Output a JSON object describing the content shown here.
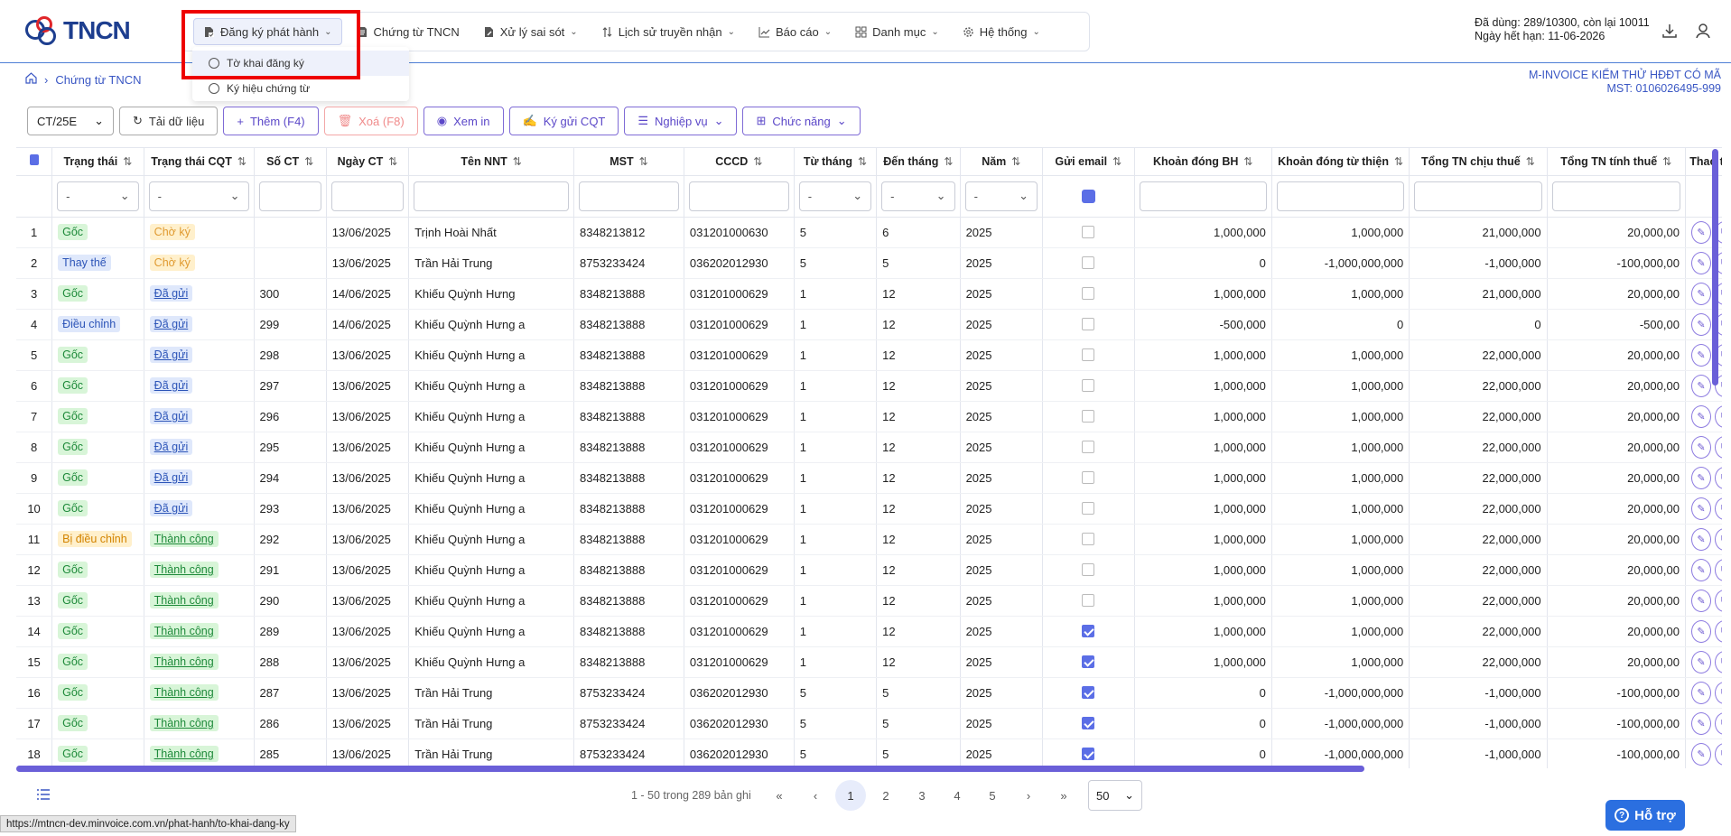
{
  "header": {
    "logo_text": "TNCN",
    "nav": [
      {
        "label": "Đăng ký phát hành",
        "icon": "file-register-icon",
        "has_menu": true
      },
      {
        "label": "Chứng từ TNCN",
        "icon": "document-icon",
        "has_menu": false
      },
      {
        "label": "Xử lý sai sót",
        "icon": "file-edit-icon",
        "has_menu": true
      },
      {
        "label": "Lịch sử truyền nhận",
        "icon": "transfer-icon",
        "has_menu": true
      },
      {
        "label": "Báo cáo",
        "icon": "chart-icon",
        "has_menu": true
      },
      {
        "label": "Danh mục",
        "icon": "grid-icon",
        "has_menu": true
      },
      {
        "label": "Hệ thống",
        "icon": "gear-icon",
        "has_menu": true
      }
    ],
    "dropdown": [
      "Tờ khai đăng ký",
      "Ký hiệu chứng từ"
    ],
    "quota_line1": "Đã dùng: 289/10300, còn lại 10011",
    "quota_line2": "Ngày hết hạn: 11-06-2026"
  },
  "breadcrumb": {
    "page": "Chứng từ TNCN"
  },
  "company": {
    "name": "M-INVOICE KIỂM THỬ HĐĐT CÓ MÃ",
    "mst": "MST: 0106026495-999"
  },
  "toolbar": {
    "series": "CT/25E",
    "reload": "Tải dữ liệu",
    "add": "Thêm (F4)",
    "delete": "Xoá (F8)",
    "view": "Xem in",
    "sign": "Ký gửi CQT",
    "ops": "Nghiệp vụ",
    "functions": "Chức năng"
  },
  "columns": [
    "Trạng thái",
    "Trạng thái CQT",
    "Số CT",
    "Ngày CT",
    "Tên NNT",
    "MST",
    "CCCD",
    "Từ tháng",
    "Đến tháng",
    "Năm",
    "Gửi email",
    "Khoản đóng BH",
    "Khoản đóng từ thiện",
    "Tổng TN chịu thuế",
    "Tổng TN tính thuế",
    "Thao tác"
  ],
  "filter_placeholder": "-",
  "rows": [
    {
      "n": "1",
      "st": "Gốc",
      "cqt": "Chờ ký",
      "so": "",
      "ngay": "13/06/2025",
      "ten": "Trịnh Hoài Nhất",
      "mst": "8348213812",
      "cccd": "031201000630",
      "tu": "5",
      "den": "6",
      "nam": "2025",
      "email": false,
      "bh": "1,000,000",
      "tt": "1,000,000",
      "chiu": "21,000,000",
      "tinh": "20,000,00"
    },
    {
      "n": "2",
      "st": "Thay thế",
      "cqt": "Chờ ký",
      "so": "",
      "ngay": "13/06/2025",
      "ten": "Trần Hải Trung",
      "mst": "8753233424",
      "cccd": "036202012930",
      "tu": "5",
      "den": "5",
      "nam": "2025",
      "email": false,
      "bh": "0",
      "tt": "-1,000,000,000",
      "chiu": "-1,000,000",
      "tinh": "-100,000,00"
    },
    {
      "n": "3",
      "st": "Gốc",
      "cqt": "Đã gửi",
      "so": "300",
      "ngay": "14/06/2025",
      "ten": "Khiếu Quỳnh Hưng",
      "mst": "8348213888",
      "cccd": "031201000629",
      "tu": "1",
      "den": "12",
      "nam": "2025",
      "email": false,
      "bh": "1,000,000",
      "tt": "1,000,000",
      "chiu": "21,000,000",
      "tinh": "20,000,00"
    },
    {
      "n": "4",
      "st": "Điều chỉnh",
      "cqt": "Đã gửi",
      "so": "299",
      "ngay": "14/06/2025",
      "ten": "Khiếu Quỳnh Hưng a",
      "mst": "8348213888",
      "cccd": "031201000629",
      "tu": "1",
      "den": "12",
      "nam": "2025",
      "email": false,
      "bh": "-500,000",
      "tt": "0",
      "chiu": "0",
      "tinh": "-500,00"
    },
    {
      "n": "5",
      "st": "Gốc",
      "cqt": "Đã gửi",
      "so": "298",
      "ngay": "13/06/2025",
      "ten": "Khiếu Quỳnh Hưng a",
      "mst": "8348213888",
      "cccd": "031201000629",
      "tu": "1",
      "den": "12",
      "nam": "2025",
      "email": false,
      "bh": "1,000,000",
      "tt": "1,000,000",
      "chiu": "22,000,000",
      "tinh": "20,000,00"
    },
    {
      "n": "6",
      "st": "Gốc",
      "cqt": "Đã gửi",
      "so": "297",
      "ngay": "13/06/2025",
      "ten": "Khiếu Quỳnh Hưng a",
      "mst": "8348213888",
      "cccd": "031201000629",
      "tu": "1",
      "den": "12",
      "nam": "2025",
      "email": false,
      "bh": "1,000,000",
      "tt": "1,000,000",
      "chiu": "22,000,000",
      "tinh": "20,000,00"
    },
    {
      "n": "7",
      "st": "Gốc",
      "cqt": "Đã gửi",
      "so": "296",
      "ngay": "13/06/2025",
      "ten": "Khiếu Quỳnh Hưng a",
      "mst": "8348213888",
      "cccd": "031201000629",
      "tu": "1",
      "den": "12",
      "nam": "2025",
      "email": false,
      "bh": "1,000,000",
      "tt": "1,000,000",
      "chiu": "22,000,000",
      "tinh": "20,000,00"
    },
    {
      "n": "8",
      "st": "Gốc",
      "cqt": "Đã gửi",
      "so": "295",
      "ngay": "13/06/2025",
      "ten": "Khiếu Quỳnh Hưng a",
      "mst": "8348213888",
      "cccd": "031201000629",
      "tu": "1",
      "den": "12",
      "nam": "2025",
      "email": false,
      "bh": "1,000,000",
      "tt": "1,000,000",
      "chiu": "22,000,000",
      "tinh": "20,000,00"
    },
    {
      "n": "9",
      "st": "Gốc",
      "cqt": "Đã gửi",
      "so": "294",
      "ngay": "13/06/2025",
      "ten": "Khiếu Quỳnh Hưng a",
      "mst": "8348213888",
      "cccd": "031201000629",
      "tu": "1",
      "den": "12",
      "nam": "2025",
      "email": false,
      "bh": "1,000,000",
      "tt": "1,000,000",
      "chiu": "22,000,000",
      "tinh": "20,000,00"
    },
    {
      "n": "10",
      "st": "Gốc",
      "cqt": "Đã gửi",
      "so": "293",
      "ngay": "13/06/2025",
      "ten": "Khiếu Quỳnh Hưng a",
      "mst": "8348213888",
      "cccd": "031201000629",
      "tu": "1",
      "den": "12",
      "nam": "2025",
      "email": false,
      "bh": "1,000,000",
      "tt": "1,000,000",
      "chiu": "22,000,000",
      "tinh": "20,000,00"
    },
    {
      "n": "11",
      "st": "Bị điều chỉnh",
      "cqt": "Thành công",
      "so": "292",
      "ngay": "13/06/2025",
      "ten": "Khiếu Quỳnh Hưng a",
      "mst": "8348213888",
      "cccd": "031201000629",
      "tu": "1",
      "den": "12",
      "nam": "2025",
      "email": false,
      "bh": "1,000,000",
      "tt": "1,000,000",
      "chiu": "22,000,000",
      "tinh": "20,000,00"
    },
    {
      "n": "12",
      "st": "Gốc",
      "cqt": "Thành công",
      "so": "291",
      "ngay": "13/06/2025",
      "ten": "Khiếu Quỳnh Hưng a",
      "mst": "8348213888",
      "cccd": "031201000629",
      "tu": "1",
      "den": "12",
      "nam": "2025",
      "email": false,
      "bh": "1,000,000",
      "tt": "1,000,000",
      "chiu": "22,000,000",
      "tinh": "20,000,00"
    },
    {
      "n": "13",
      "st": "Gốc",
      "cqt": "Thành công",
      "so": "290",
      "ngay": "13/06/2025",
      "ten": "Khiếu Quỳnh Hưng a",
      "mst": "8348213888",
      "cccd": "031201000629",
      "tu": "1",
      "den": "12",
      "nam": "2025",
      "email": false,
      "bh": "1,000,000",
      "tt": "1,000,000",
      "chiu": "22,000,000",
      "tinh": "20,000,00"
    },
    {
      "n": "14",
      "st": "Gốc",
      "cqt": "Thành công",
      "so": "289",
      "ngay": "13/06/2025",
      "ten": "Khiếu Quỳnh Hưng a",
      "mst": "8348213888",
      "cccd": "031201000629",
      "tu": "1",
      "den": "12",
      "nam": "2025",
      "email": true,
      "bh": "1,000,000",
      "tt": "1,000,000",
      "chiu": "22,000,000",
      "tinh": "20,000,00"
    },
    {
      "n": "15",
      "st": "Gốc",
      "cqt": "Thành công",
      "so": "288",
      "ngay": "13/06/2025",
      "ten": "Khiếu Quỳnh Hưng a",
      "mst": "8348213888",
      "cccd": "031201000629",
      "tu": "1",
      "den": "12",
      "nam": "2025",
      "email": true,
      "bh": "1,000,000",
      "tt": "1,000,000",
      "chiu": "22,000,000",
      "tinh": "20,000,00"
    },
    {
      "n": "16",
      "st": "Gốc",
      "cqt": "Thành công",
      "so": "287",
      "ngay": "13/06/2025",
      "ten": "Trần Hải Trung",
      "mst": "8753233424",
      "cccd": "036202012930",
      "tu": "5",
      "den": "5",
      "nam": "2025",
      "email": true,
      "bh": "0",
      "tt": "-1,000,000,000",
      "chiu": "-1,000,000",
      "tinh": "-100,000,00"
    },
    {
      "n": "17",
      "st": "Gốc",
      "cqt": "Thành công",
      "so": "286",
      "ngay": "13/06/2025",
      "ten": "Trần Hải Trung",
      "mst": "8753233424",
      "cccd": "036202012930",
      "tu": "5",
      "den": "5",
      "nam": "2025",
      "email": true,
      "bh": "0",
      "tt": "-1,000,000,000",
      "chiu": "-1,000,000",
      "tinh": "-100,000,00"
    },
    {
      "n": "18",
      "st": "Gốc",
      "cqt": "Thành công",
      "so": "285",
      "ngay": "13/06/2025",
      "ten": "Trần Hải Trung",
      "mst": "8753233424",
      "cccd": "036202012930",
      "tu": "5",
      "den": "5",
      "nam": "2025",
      "email": true,
      "bh": "0",
      "tt": "-1,000,000,000",
      "chiu": "-1,000,000",
      "tinh": "-100,000,00"
    }
  ],
  "pager": {
    "info": "1 - 50 trong 289 bản ghi",
    "pages": [
      "1",
      "2",
      "3",
      "4",
      "5"
    ],
    "current": "1",
    "page_size": "50"
  },
  "support_label": "Hỗ trợ",
  "status_url": "https://mtncn-dev.minvoice.com.vn/phat-hanh/to-khai-dang-ky",
  "colors": {
    "accent": "#5b47c8",
    "brand_blue": "#1d3e8f",
    "brand_red": "#e0262a",
    "highlight_box": "#ee0000"
  }
}
